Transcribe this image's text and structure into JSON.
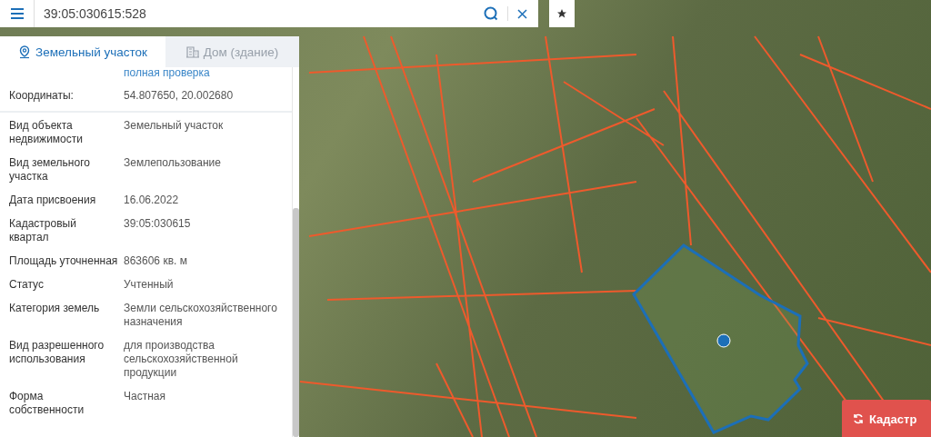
{
  "search": {
    "value": "39:05:030615:528"
  },
  "tabs": [
    {
      "label": "Земельный участок",
      "selected": true
    },
    {
      "label": "Дом (здание)",
      "selected": false
    }
  ],
  "link": "полная проверка",
  "properties": [
    {
      "label": "Координаты:",
      "value": "54.807650, 20.002680"
    },
    {
      "label": "Вид объекта недвижимости",
      "value": "Земельный участок"
    },
    {
      "label": "Вид земельного участка",
      "value": "Землепользование"
    },
    {
      "label": "Дата присвоения",
      "value": "16.06.2022"
    },
    {
      "label": "Кадастровый квартал",
      "value": "39:05:030615"
    },
    {
      "label": "Площадь уточненная",
      "value": "863606 кв. м"
    },
    {
      "label": "Статус",
      "value": "Учтенный"
    },
    {
      "label": "Категория земель",
      "value": "Земли сельскохозяйственного назначения"
    },
    {
      "label": "Вид разрешенного использования",
      "value": "для производства сельскохозяйственной продукции"
    },
    {
      "label": "Форма собственности",
      "value": "Частная"
    }
  ],
  "action_button": {
    "label": "Кадастр"
  }
}
